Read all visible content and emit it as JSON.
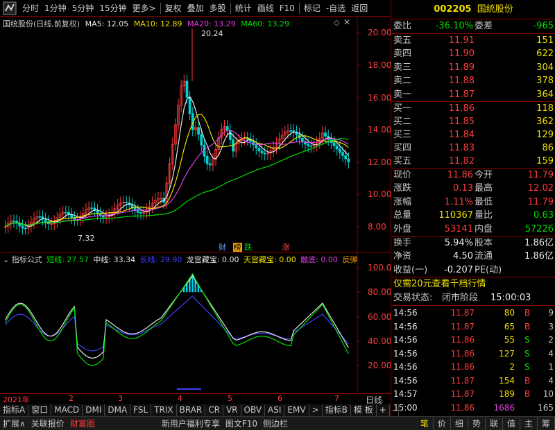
{
  "toolbar": {
    "items": [
      "分时",
      "1分钟",
      "5分钟",
      "15分钟",
      "更多>",
      "复权",
      "叠加",
      "多股",
      "统计",
      "画线",
      "F10",
      "标记",
      "-自选",
      "返回"
    ]
  },
  "stock": {
    "code": "002205",
    "name": "国统股份"
  },
  "main_chart": {
    "title": "国统股份(日线,前复权)",
    "ma5": "MA5: 12.05",
    "ma10": "MA10: 12.89",
    "ma20": "MA20: 13.29",
    "ma60": "MA60: 13.29",
    "high_label": "20.24",
    "low_label": "7.32",
    "y_ticks": [
      "20.00",
      "18.00",
      "16.00",
      "14.00",
      "12.00",
      "10.00",
      "8.00"
    ],
    "markers": [
      "财",
      "榜",
      "跌",
      "涨"
    ]
  },
  "indicator": {
    "title": "指标公式",
    "short": "短线: 27.57",
    "mid": "中线: 33.34",
    "long": "长线: 29.90",
    "lg": "龙宫藏宝: 0.00",
    "tg": "天宫藏宝: 0.00",
    "cd": "触底: 0.00",
    "fx": "反弹",
    "y_ticks": [
      "100.0",
      "80.00",
      "60.00",
      "40.00",
      "20.00"
    ]
  },
  "time_axis": {
    "labels": [
      "2021年",
      "2",
      "3",
      "4",
      "5",
      "6",
      "7"
    ],
    "period": "日线"
  },
  "indicator_tabs": [
    "指标A",
    "窗口",
    "MACD",
    "DMI",
    "DMA",
    "FSL",
    "TRIX",
    "BRAR",
    "CR",
    "VR",
    "OBV",
    "ASI",
    "EMV",
    ">",
    "指标B",
    "模 板",
    "+",
    "-"
  ],
  "status_bar": [
    "扩展∧",
    "关联报价",
    "财富圈",
    "新用户福利专享",
    "图文F10",
    "侧边栏"
  ],
  "status_right": [
    "笔",
    "价",
    "细",
    "势",
    "联",
    "值",
    "主",
    "筹"
  ],
  "quote": {
    "wb_label": "委比",
    "wb": "-36.10%",
    "wc_label": "委差",
    "wc": "-965",
    "asks": [
      {
        "label": "卖五",
        "price": "11.91",
        "vol": "151"
      },
      {
        "label": "卖四",
        "price": "11.90",
        "vol": "622"
      },
      {
        "label": "卖三",
        "price": "11.89",
        "vol": "304"
      },
      {
        "label": "卖二",
        "price": "11.88",
        "vol": "378"
      },
      {
        "label": "卖一",
        "price": "11.87",
        "vol": "364"
      }
    ],
    "bids": [
      {
        "label": "买一",
        "price": "11.86",
        "vol": "118"
      },
      {
        "label": "买二",
        "price": "11.85",
        "vol": "362"
      },
      {
        "label": "买三",
        "price": "11.84",
        "vol": "129"
      },
      {
        "label": "买四",
        "price": "11.83",
        "vol": "86"
      },
      {
        "label": "买五",
        "price": "11.82",
        "vol": "159"
      }
    ],
    "stats": [
      {
        "l1": "现价",
        "v1": "11.86",
        "l2": "今开",
        "v2": "11.79"
      },
      {
        "l1": "涨跌",
        "v1": "0.13",
        "l2": "最高",
        "v2": "12.02"
      },
      {
        "l1": "涨幅",
        "v1": "1.11%",
        "l2": "最低",
        "v2": "11.79"
      },
      {
        "l1": "总量",
        "v1": "110367",
        "l2": "量比",
        "v2": "0.63"
      },
      {
        "l1": "外盘",
        "v1": "53141",
        "l2": "内盘",
        "v2": "57226"
      }
    ],
    "stats2": [
      {
        "l1": "换手",
        "v1": "5.94%",
        "l2": "股本",
        "v2": "1.86亿"
      },
      {
        "l1": "净资",
        "v1": "4.50",
        "l2": "流通",
        "v2": "1.86亿"
      },
      {
        "l1": "收益(一)",
        "v1": "-0.207",
        "l2": "PE(动)",
        "v2": ""
      }
    ],
    "promo": "仅需20元查看千档行情",
    "trade_state_label": "交易状态:",
    "trade_state": "闭市阶段",
    "trade_time": "15:00:03",
    "ticks": [
      {
        "t": "14:56",
        "p": "11.87",
        "v": "80",
        "d": "B",
        "n": "9"
      },
      {
        "t": "14:56",
        "p": "11.87",
        "v": "65",
        "d": "B",
        "n": "3"
      },
      {
        "t": "14:56",
        "p": "11.86",
        "v": "55",
        "d": "S",
        "n": "2"
      },
      {
        "t": "14:56",
        "p": "11.86",
        "v": "127",
        "d": "S",
        "n": "4"
      },
      {
        "t": "14:56",
        "p": "11.86",
        "v": "2",
        "d": "S",
        "n": "1"
      },
      {
        "t": "14:56",
        "p": "11.87",
        "v": "154",
        "d": "B",
        "n": "4"
      },
      {
        "t": "14:57",
        "p": "11.87",
        "v": "189",
        "d": "B",
        "n": "10"
      },
      {
        "t": "15:00",
        "p": "11.86",
        "v": "1686",
        "d": "",
        "n": "165"
      }
    ]
  }
}
